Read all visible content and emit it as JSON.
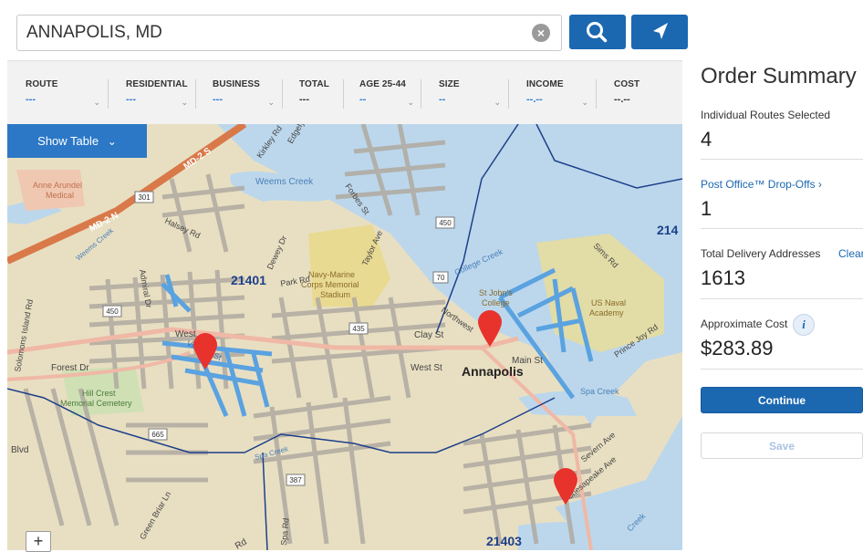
{
  "search": {
    "value": "ANNAPOLIS, MD"
  },
  "filters": [
    {
      "label": "ROUTE",
      "value": "---"
    },
    {
      "label": "RESIDENTIAL",
      "value": "---"
    },
    {
      "label": "BUSINESS",
      "value": "---"
    },
    {
      "label": "TOTAL",
      "value": "---"
    },
    {
      "label": "AGE 25-44",
      "value": "--"
    },
    {
      "label": "SIZE",
      "value": "--"
    },
    {
      "label": "INCOME",
      "value": "--.--"
    },
    {
      "label": "COST",
      "value": "--.--"
    }
  ],
  "map": {
    "show_table_label": "Show Table",
    "labels": {
      "zip_21401": "21401",
      "zip_21403": "21403",
      "zip_214": "214",
      "annapolis": "Annapolis",
      "weems_creek": "Weems Creek",
      "weems_creek2": "Weems Creek",
      "anne_arundel": "Anne Arundel",
      "medical": "Medical",
      "navy1": "Navy-Marine",
      "navy2": "Corps Memorial",
      "navy3": "Stadium",
      "st_johns1": "St John's",
      "st_johns2": "College",
      "naval1": "US Naval",
      "naval2": "Academy",
      "hill1": "Hill Crest",
      "hill2": "Memorial Cemetery",
      "forest_dr": "Forest Dr",
      "west_st": "West St",
      "west": "West",
      "main_st": "Main St",
      "clay_st": "Clay St",
      "northwest": "Northwest",
      "sims_rd": "Sims Rd",
      "severn_ave": "Severn Ave",
      "chesapeake_ave": "Chesapeake Ave",
      "spa_creek": "Spa Creek",
      "spa_creek2": "Spa Creek",
      "college_creek": "College Creek",
      "taylor_ave": "Taylor Ave",
      "forbes_st": "Forbes St",
      "kirkley_rd": "Kirkley Rd",
      "edgely_ave": "Edgely Ave",
      "admiral_dr": "Admiral Dr",
      "halsey_rd": "Halsey Rd",
      "dewey_dr": "Dewey Dr",
      "park_rd": "Park Rd",
      "md2s": "MD-2 S",
      "md2n": "MD-2 N",
      "solomons": "Solomons Island Rd",
      "blvd": "Blvd",
      "green_briar": "Green Briar Ln",
      "spa_rd": "Spa Rd",
      "rd": "Rd",
      "virginia_st": "Virginia St",
      "prince_joy": "Prince Joy Rd",
      "creek": "Creek",
      "shield_301": "301",
      "shield_450": "450",
      "shield_450b": "450",
      "shield_70": "70",
      "shield_435": "435",
      "shield_665": "665",
      "shield_387": "387"
    }
  },
  "zoom": {
    "plus": "+"
  },
  "summary": {
    "title": "Order Summary",
    "routes_label": "Individual Routes Selected",
    "routes_value": "4",
    "po_label": "Post Office™ Drop-Offs ›",
    "po_value": "1",
    "addresses_label": "Total Delivery Addresses",
    "clear_label": "Clear",
    "addresses_value": "1613",
    "cost_label": "Approximate Cost",
    "cost_value": "$283.89",
    "continue_label": "Continue",
    "save_label": "Save"
  },
  "colors": {
    "accent": "#1b68b1",
    "pin": "#e8322c",
    "route": "#5aa2e0",
    "water": "#bcd7ec",
    "land": "#e8dfc2"
  }
}
